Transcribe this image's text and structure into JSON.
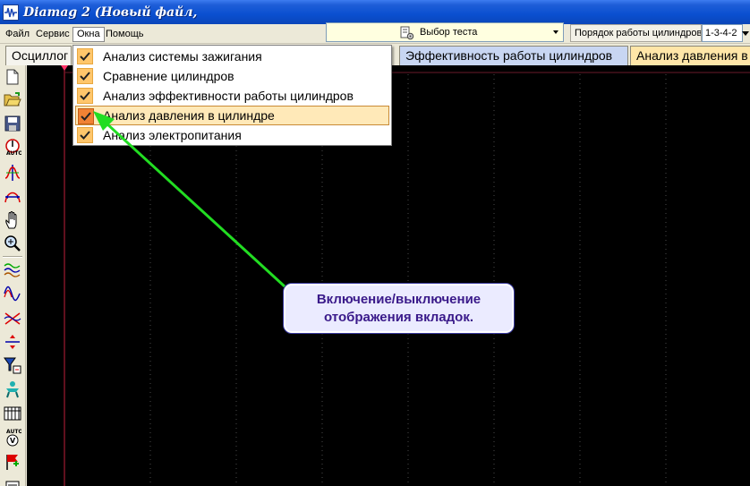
{
  "window": {
    "title": "Diamag 2 (Новый файл,"
  },
  "menu": {
    "items": [
      "Файл",
      "Сервис",
      "Окна",
      "Помощь"
    ],
    "active": "Окна"
  },
  "toolbar_top": {
    "test_select": {
      "value": "Выбор теста"
    },
    "order_label": "Порядок работы цилиндров",
    "order_value": "1-3-4-2"
  },
  "tabs": [
    {
      "label": "Осциллог"
    },
    {
      "label": "Эффективность работы цилиндров"
    },
    {
      "label": "Анализ давления в"
    }
  ],
  "dropdown": {
    "items": [
      {
        "label": "Анализ системы зажигания",
        "checked": true,
        "highlighted": false
      },
      {
        "label": "Сравнение цилиндров",
        "checked": true,
        "highlighted": false
      },
      {
        "label": "Анализ эффективности работы цилиндров",
        "checked": true,
        "highlighted": false
      },
      {
        "label": "Анализ давления в цилиндре",
        "checked": true,
        "highlighted": true
      },
      {
        "label": "Анализ электропитания",
        "checked": true,
        "highlighted": false
      }
    ]
  },
  "callout": {
    "line1": "Включение/выключение",
    "line2": "отображения вкладок."
  },
  "left_tools": [
    "new-file-icon",
    "open-folder-icon",
    "save-disk-icon",
    "auto-trigger-icon",
    "sync-icon",
    "cursor-measure-icon",
    "hand-pan-icon",
    "zoom-icon",
    "waves-icon",
    "sine-wave-icon",
    "cross-wave-icon",
    "level-icon",
    "filter-icon",
    "person-channel-icon",
    "table-grid-icon",
    "auto-volume-icon",
    "flag-icon",
    "stack-icon"
  ],
  "colors": {
    "titlebar": "#0a4fd0",
    "scope_bg": "#000000",
    "grid": "#4a4a4a",
    "cursor_line": "#c0203a",
    "arrow": "#22dd22",
    "callout_bg": "#ebebff",
    "callout_text": "#3a1a8a",
    "tab_efficiency": "#c8d6f2",
    "tab_pressure": "#ffe6a8",
    "check": "#ffc66b",
    "check_highlight": "#f08234"
  }
}
